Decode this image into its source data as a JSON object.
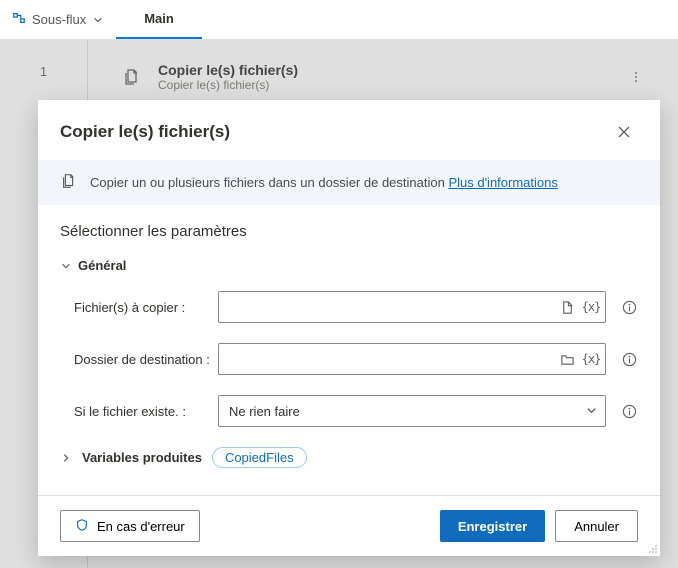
{
  "tabbar": {
    "subflows_label": "Sous-flux",
    "main_tab": "Main"
  },
  "canvas": {
    "line_number": "1",
    "action_title": "Copier le(s) fichier(s)",
    "action_subtitle": "Copier le(s) fichier(s)"
  },
  "dialog": {
    "title": "Copier le(s) fichier(s)",
    "info_text": "Copier un ou plusieurs fichiers dans un dossier de destination ",
    "info_link": "Plus d'informations",
    "section_title": "Sélectionner les paramètres",
    "group_general": "Général",
    "fields": {
      "files_label": "Fichier(s) à copier :",
      "files_value": "",
      "dest_label": "Dossier de destination :",
      "dest_value": "",
      "exists_label": "Si le fichier existe. :",
      "exists_value": "Ne rien faire"
    },
    "vars_label": "Variables produites",
    "vars_pill": "CopiedFiles",
    "on_error": "En cas d'erreur",
    "save": "Enregistrer",
    "cancel": "Annuler"
  }
}
